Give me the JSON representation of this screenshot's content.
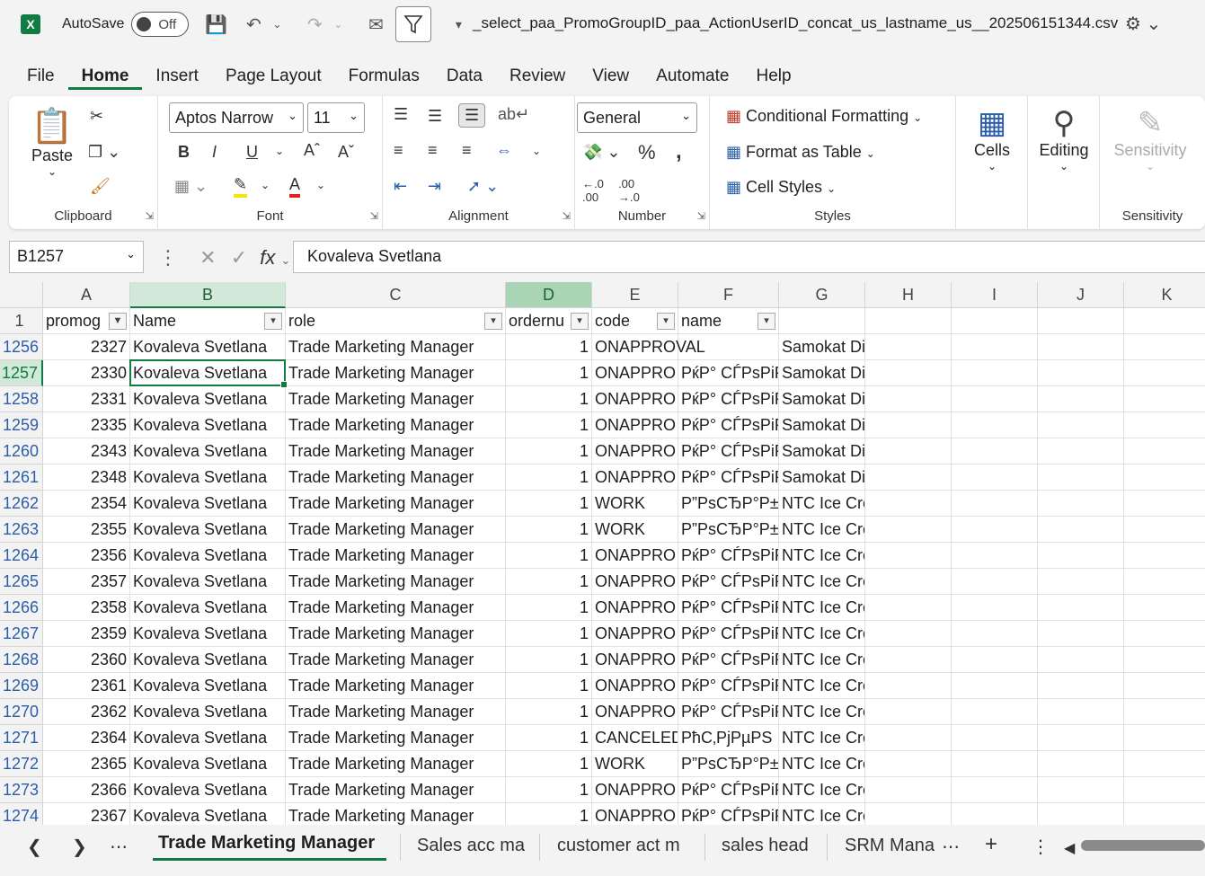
{
  "titlebar": {
    "autosave_label": "AutoSave",
    "toggle_label": "Off",
    "doc_title": "_select_paa_PromoGroupID_paa_ActionUserID_concat_us_lastname_us__202506151344.csv"
  },
  "menu_tabs": [
    "File",
    "Home",
    "Insert",
    "Page Layout",
    "Formulas",
    "Data",
    "Review",
    "View",
    "Automate",
    "Help"
  ],
  "ribbon": {
    "clipboard": {
      "label": "Clipboard",
      "paste": "Paste"
    },
    "font": {
      "label": "Font",
      "font_name": "Aptos Narrow",
      "font_size": "11"
    },
    "alignment": {
      "label": "Alignment"
    },
    "number": {
      "label": "Number",
      "format": "General"
    },
    "styles": {
      "label": "Styles",
      "conditional": "Conditional Formatting",
      "format_table": "Format as Table",
      "cell_styles": "Cell Styles"
    },
    "cells": {
      "label": "Cells"
    },
    "editing": {
      "label": "Editing"
    },
    "sensitivity": {
      "label": "Sensitivity",
      "button": "Sensitivity"
    }
  },
  "formula_bar": {
    "name_box": "B1257",
    "formula": "Kovaleva Svetlana"
  },
  "columns": [
    "A",
    "B",
    "C",
    "D",
    "E",
    "F",
    "G",
    "H",
    "I",
    "J",
    "K"
  ],
  "header_row": {
    "row_num": "1",
    "cells": [
      "promog",
      "Name",
      "role",
      "ordernu",
      "code",
      "name",
      ""
    ]
  },
  "rows": [
    {
      "n": "1256",
      "a": "2327",
      "b": "Kovaleva Svetlana",
      "c": "Trade Marketing Manager",
      "d": "1",
      "e": "ONAPPROVAL",
      "f": "",
      "g": "Samokat Direct"
    },
    {
      "n": "1257",
      "a": "2330",
      "b": "Kovaleva Svetlana",
      "c": "Trade Marketing Manager",
      "d": "1",
      "e": "ONAPPRO",
      "f": "РќР° СЃРѕРіР»",
      "g": "Samokat Direct"
    },
    {
      "n": "1258",
      "a": "2331",
      "b": "Kovaleva Svetlana",
      "c": "Trade Marketing Manager",
      "d": "1",
      "e": "ONAPPRO",
      "f": "РќР° СЃРѕРіР»",
      "g": "Samokat Direct"
    },
    {
      "n": "1259",
      "a": "2335",
      "b": "Kovaleva Svetlana",
      "c": "Trade Marketing Manager",
      "d": "1",
      "e": "ONAPPRO",
      "f": "РќР° СЃРѕРіР»",
      "g": "Samokat Direct"
    },
    {
      "n": "1260",
      "a": "2343",
      "b": "Kovaleva Svetlana",
      "c": "Trade Marketing Manager",
      "d": "1",
      "e": "ONAPPRO",
      "f": "РќР° СЃРѕРіР»",
      "g": "Samokat Direct"
    },
    {
      "n": "1261",
      "a": "2348",
      "b": "Kovaleva Svetlana",
      "c": "Trade Marketing Manager",
      "d": "1",
      "e": "ONAPPRO",
      "f": "РќР° СЃРѕРіР»",
      "g": "Samokat Direct"
    },
    {
      "n": "1262",
      "a": "2354",
      "b": "Kovaleva Svetlana",
      "c": "Trade Marketing Manager",
      "d": "1",
      "e": "WORK",
      "f": "Р”РѕСЂР°Р±",
      "g": "NTC Ice Cream"
    },
    {
      "n": "1263",
      "a": "2355",
      "b": "Kovaleva Svetlana",
      "c": "Trade Marketing Manager",
      "d": "1",
      "e": "WORK",
      "f": "Р”РѕСЂР°Р±",
      "g": "NTC Ice Cream"
    },
    {
      "n": "1264",
      "a": "2356",
      "b": "Kovaleva Svetlana",
      "c": "Trade Marketing Manager",
      "d": "1",
      "e": "ONAPPRO",
      "f": "РќР° СЃРѕРіР»",
      "g": "NTC Ice Cream"
    },
    {
      "n": "1265",
      "a": "2357",
      "b": "Kovaleva Svetlana",
      "c": "Trade Marketing Manager",
      "d": "1",
      "e": "ONAPPRO",
      "f": "РќР° СЃРѕРіР»",
      "g": "NTC Ice Cream"
    },
    {
      "n": "1266",
      "a": "2358",
      "b": "Kovaleva Svetlana",
      "c": "Trade Marketing Manager",
      "d": "1",
      "e": "ONAPPRO",
      "f": "РќР° СЃРѕРіР»",
      "g": "NTC Ice Cream"
    },
    {
      "n": "1267",
      "a": "2359",
      "b": "Kovaleva Svetlana",
      "c": "Trade Marketing Manager",
      "d": "1",
      "e": "ONAPPRO",
      "f": "РќР° СЃРѕРіР»",
      "g": "NTC Ice Cream"
    },
    {
      "n": "1268",
      "a": "2360",
      "b": "Kovaleva Svetlana",
      "c": "Trade Marketing Manager",
      "d": "1",
      "e": "ONAPPRO",
      "f": "РќР° СЃРѕРіР»",
      "g": "NTC Ice Cream"
    },
    {
      "n": "1269",
      "a": "2361",
      "b": "Kovaleva Svetlana",
      "c": "Trade Marketing Manager",
      "d": "1",
      "e": "ONAPPRO",
      "f": "РќР° СЃРѕРіР»",
      "g": "NTC Ice Cream"
    },
    {
      "n": "1270",
      "a": "2362",
      "b": "Kovaleva Svetlana",
      "c": "Trade Marketing Manager",
      "d": "1",
      "e": "ONAPPRO",
      "f": "РќР° СЃРѕРіР»",
      "g": "NTC Ice Cream"
    },
    {
      "n": "1271",
      "a": "2364",
      "b": "Kovaleva Svetlana",
      "c": "Trade Marketing Manager",
      "d": "1",
      "e": "CANCELED",
      "f": "РћС‚РјРµРЅ",
      "g": "NTC Ice Cream"
    },
    {
      "n": "1272",
      "a": "2365",
      "b": "Kovaleva Svetlana",
      "c": "Trade Marketing Manager",
      "d": "1",
      "e": "WORK",
      "f": "Р”РѕСЂР°Р±",
      "g": "NTC Ice Cream"
    },
    {
      "n": "1273",
      "a": "2366",
      "b": "Kovaleva Svetlana",
      "c": "Trade Marketing Manager",
      "d": "1",
      "e": "ONAPPRO",
      "f": "РќР° СЃРѕРіР»",
      "g": "NTC Ice Cream"
    },
    {
      "n": "1274",
      "a": "2367",
      "b": "Kovaleva Svetlana",
      "c": "Trade Marketing Manager",
      "d": "1",
      "e": "ONAPPRO",
      "f": "РќР° СЃРѕРіР»",
      "g": "NTC Ice Cream"
    }
  ],
  "sheet_tabs": [
    "Trade Marketing Manager",
    "Sales acc ma",
    "customer act m",
    "sales head",
    "SRM Mana"
  ],
  "colors": {
    "accent": "#107c41",
    "row_number": "#2c5ea8"
  }
}
